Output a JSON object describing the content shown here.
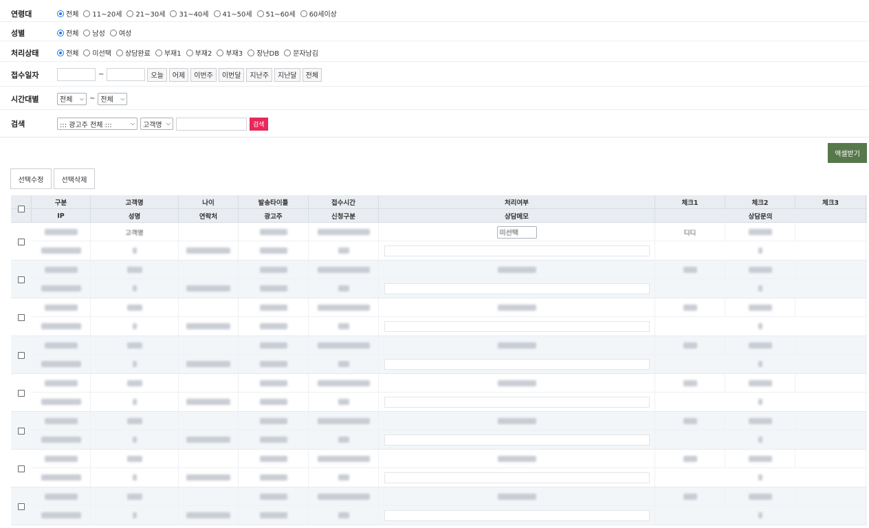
{
  "filters": {
    "age": {
      "label": "연령대",
      "options": [
        "전체",
        "11~20세",
        "21~30세",
        "31~40세",
        "41~50세",
        "51~60세",
        "60세이상"
      ],
      "selected": 0
    },
    "gender": {
      "label": "성별",
      "options": [
        "전체",
        "남성",
        "여성"
      ],
      "selected": 0
    },
    "status": {
      "label": "처리상태",
      "options": [
        "전체",
        "미선택",
        "상담완료",
        "부재1",
        "부재2",
        "부재3",
        "장난DB",
        "문자남김"
      ],
      "selected": 0
    },
    "date": {
      "label": "접수일자",
      "tilde": "~",
      "buttons": [
        "오늘",
        "어제",
        "이번주",
        "이번달",
        "지난주",
        "지난달",
        "전체"
      ]
    },
    "time": {
      "label": "시간대별",
      "from": "전체",
      "tilde": "~",
      "to": "전체"
    },
    "search": {
      "label": "검색",
      "advertiser": "::: 광고주 전체 :::",
      "field": "고객명",
      "button": "검색"
    }
  },
  "actions": {
    "excel": "엑셀받기",
    "edit": "선택수정",
    "delete": "선택삭제"
  },
  "table": {
    "header_top": [
      "구분",
      "고객명",
      "나이",
      "발송타이틀",
      "접수시간",
      "처리여부",
      "체크1",
      "체크2",
      "체크3"
    ],
    "header_bottom": [
      "IP",
      "성명",
      "연락처",
      "광고주",
      "신청구분",
      "상담메모",
      "상담문의"
    ],
    "first_row": {
      "name": "고객명",
      "status": "미선택",
      "check1": "디디"
    }
  }
}
